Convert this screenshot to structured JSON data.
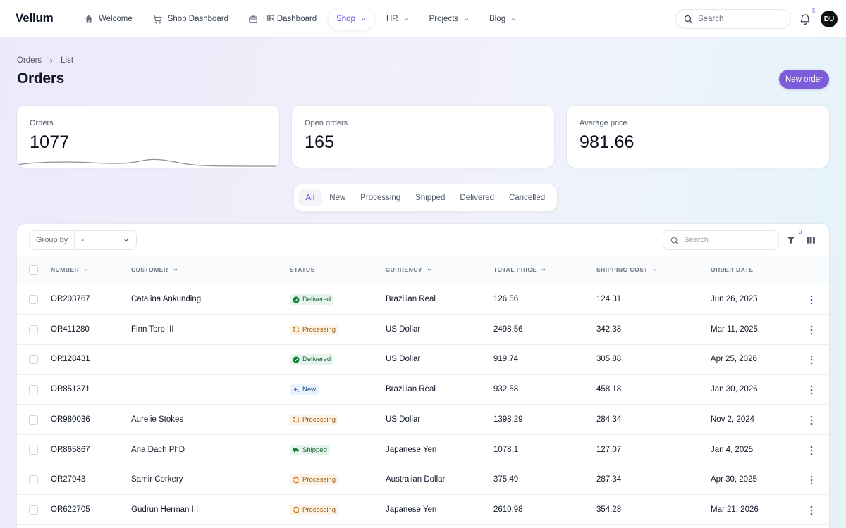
{
  "app": {
    "brand": "Vellum"
  },
  "nav": {
    "items": [
      {
        "label": "Welcome",
        "icon": "home-icon",
        "active": false,
        "dropdown": false
      },
      {
        "label": "Shop Dashboard",
        "icon": "cart-icon",
        "active": false,
        "dropdown": false
      },
      {
        "label": "HR Dashboard",
        "icon": "briefcase-icon",
        "active": false,
        "dropdown": false
      },
      {
        "label": "Shop",
        "icon": "",
        "active": true,
        "dropdown": true
      },
      {
        "label": "HR",
        "icon": "",
        "active": false,
        "dropdown": true
      },
      {
        "label": "Projects",
        "icon": "",
        "active": false,
        "dropdown": true
      },
      {
        "label": "Blog",
        "icon": "",
        "active": false,
        "dropdown": true
      }
    ],
    "search_placeholder": "Search",
    "notification_count": "5",
    "avatar_initials": "DU"
  },
  "header": {
    "breadcrumb": [
      "Orders",
      "List"
    ],
    "title": "Orders",
    "new_button": "New order"
  },
  "stats": [
    {
      "label": "Orders",
      "value": "1077"
    },
    {
      "label": "Open orders",
      "value": "165"
    },
    {
      "label": "Average price",
      "value": "981.66"
    }
  ],
  "tabs": [
    "All",
    "New",
    "Processing",
    "Shipped",
    "Delivered",
    "Cancelled"
  ],
  "active_tab": "All",
  "toolbar": {
    "group_by_label": "Group by",
    "group_by_value": "-",
    "search_placeholder": "Search",
    "filter_count": "0"
  },
  "table": {
    "columns": [
      "Number",
      "Customer",
      "Status",
      "Currency",
      "Total price",
      "Shipping cost",
      "Order date"
    ],
    "rows": [
      {
        "number": "OR203767",
        "customer": "Catalina Ankunding",
        "status": "Delivered",
        "currency": "Brazilian Real",
        "total": "126.56",
        "shipping": "124.31",
        "date": "Jun 26, 2025"
      },
      {
        "number": "OR411280",
        "customer": "Finn Torp III",
        "status": "Processing",
        "currency": "US Dollar",
        "total": "2498.56",
        "shipping": "342.38",
        "date": "Mar 11, 2025"
      },
      {
        "number": "OR128431",
        "customer": "",
        "status": "Delivered",
        "currency": "US Dollar",
        "total": "919.74",
        "shipping": "305.88",
        "date": "Apr 25, 2026"
      },
      {
        "number": "OR851371",
        "customer": "",
        "status": "New",
        "currency": "Brazilian Real",
        "total": "932.58",
        "shipping": "458.18",
        "date": "Jan 30, 2026"
      },
      {
        "number": "OR980036",
        "customer": "Aurelie Stokes",
        "status": "Processing",
        "currency": "US Dollar",
        "total": "1398.29",
        "shipping": "284.34",
        "date": "Nov 2, 2024"
      },
      {
        "number": "OR865867",
        "customer": "Ana Dach PhD",
        "status": "Shipped",
        "currency": "Japanese Yen",
        "total": "1078.1",
        "shipping": "127.07",
        "date": "Jan 4, 2025"
      },
      {
        "number": "OR27943",
        "customer": "Samir Corkery",
        "status": "Processing",
        "currency": "Australian Dollar",
        "total": "375.49",
        "shipping": "287.34",
        "date": "Apr 30, 2025"
      },
      {
        "number": "OR622705",
        "customer": "Gudrun Herman III",
        "status": "Processing",
        "currency": "Japanese Yen",
        "total": "2610.98",
        "shipping": "354.28",
        "date": "Mar 21, 2026"
      }
    ]
  },
  "colors": {
    "accent": "#7c5cdb",
    "delivered": "#166534",
    "processing": "#9a5b12",
    "new": "#1e4f8f"
  }
}
